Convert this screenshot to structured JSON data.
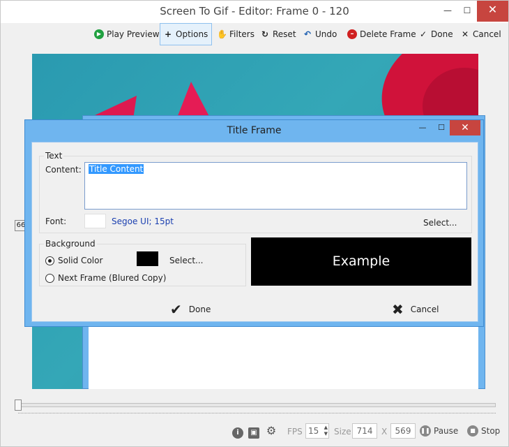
{
  "window": {
    "title": "Screen To Gif - Editor: Frame 0 - 120",
    "minimize_glyph": "—",
    "maximize_glyph": "☐",
    "close_glyph": "✕"
  },
  "toolbar": {
    "play_preview": "Play Preview",
    "options": "Options",
    "filters": "Filters",
    "reset": "Reset",
    "undo": "Undo",
    "delete_frame": "Delete Frame",
    "done": "Done",
    "cancel": "Cancel",
    "icons": {
      "play": "▶",
      "plus": "+",
      "hand": "✋",
      "reset": "↻",
      "undo": "↶",
      "delete": "–",
      "check": "✓",
      "x": "✕"
    }
  },
  "side_badge": "66",
  "status_bar": {
    "fps_label": "FPS",
    "fps_value": "15",
    "size_label": "Size",
    "width": "714",
    "x_label": "X",
    "height": "569",
    "pause": "Pause",
    "stop": "Stop",
    "icons": {
      "info": "i",
      "image": "▣",
      "gear": "⚙",
      "pause": "❚❚",
      "stop": "■"
    }
  },
  "dialog": {
    "title": "Title Frame",
    "minimize_glyph": "—",
    "maximize_glyph": "☐",
    "close_glyph": "✕",
    "text_group": {
      "label": "Text",
      "content_label": "Content:",
      "content_value": "Title Content",
      "font_label": "Font:",
      "font_value": "Segoe UI; 15pt",
      "font_select": "Select..."
    },
    "background_group": {
      "label": "Background",
      "solid_color": "Solid Color",
      "next_frame": "Next Frame (Blured Copy)",
      "select": "Select...",
      "selected_option": "solid_color",
      "color": "#000000"
    },
    "example_text": "Example",
    "done_label": "Done",
    "cancel_label": "Cancel",
    "done_icon": "✔",
    "cancel_icon": "✖"
  }
}
